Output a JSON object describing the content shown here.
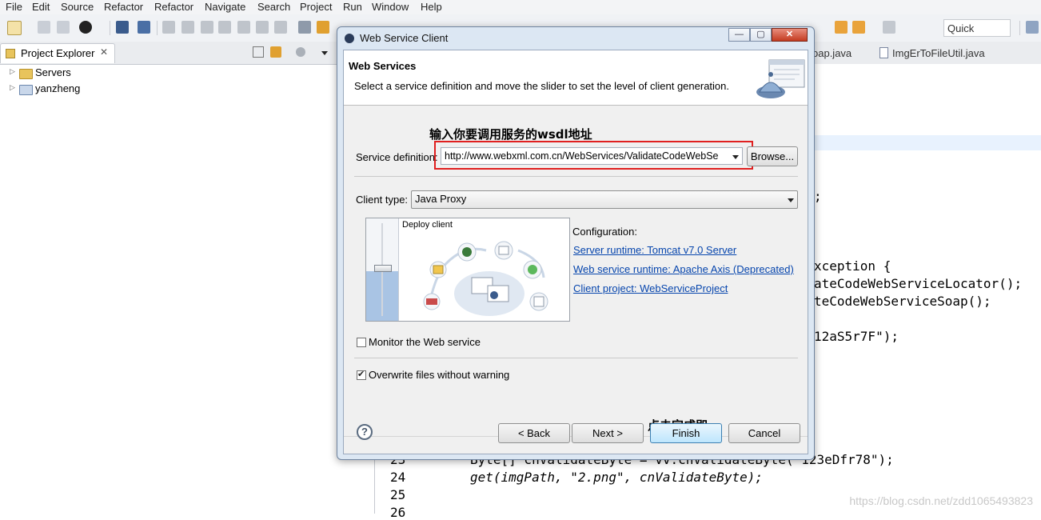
{
  "menu": [
    "File",
    "Edit",
    "Source",
    "Refactor",
    "Refactor",
    "Navigate",
    "Search",
    "Project",
    "Run",
    "Window",
    "Help"
  ],
  "toolbar": {
    "quick_access": "Quick Access"
  },
  "project_explorer": {
    "tab_label": "Project Explorer",
    "items": [
      {
        "label": "Servers"
      },
      {
        "label": "yanzheng"
      }
    ]
  },
  "editor": {
    "tabs": [
      "oap.java",
      "ImgErToFileUtil.java"
    ],
    "code_fragments": {
      "semicolon": ";",
      "l1": "xception {",
      "l2": "ateCodeWebServiceLocator();",
      "l3": "teCodeWebServiceSoap();",
      "l4": "12aS5r7F\");",
      "l23_code": "Byte[] cnValidateByte = vv.cnValidateByte(\"123eDfr78\");",
      "l24_code": "get(imgPath, \"2.png\", cnValidateByte);"
    },
    "line_numbers": {
      "l23": "23",
      "l24": "24",
      "l25": "25",
      "l26": "26"
    },
    "watermark": "https://blog.csdn.net/zdd1065493823"
  },
  "dialog": {
    "title": "Web Service Client",
    "banner_title": "Web Services",
    "banner_desc": "Select a service definition and move the slider to set the level of client generation.",
    "note_wsdl": "输入你要调用服务的wsdl地址",
    "service_definition_label": "Service definition:",
    "service_definition_value": "http://www.webxml.com.cn/WebServices/ValidateCodeWebSe",
    "browse_label": "Browse...",
    "client_type_label": "Client type:",
    "client_type_value": "Java Proxy",
    "slider_level_label": "Deploy client",
    "configuration_label": "Configuration:",
    "config_links": [
      "Server runtime: Tomcat v7.0 Server",
      "Web service runtime: Apache Axis (Deprecated)",
      "Client project: WebServiceProject"
    ],
    "monitor_label": "Monitor the Web service",
    "monitor_checked": false,
    "overwrite_label": "Overwrite files without warning",
    "overwrite_checked": true,
    "note_finish": "点击完成即",
    "buttons": {
      "back": "< Back",
      "next": "Next >",
      "finish": "Finish",
      "cancel": "Cancel"
    },
    "help": "?"
  }
}
